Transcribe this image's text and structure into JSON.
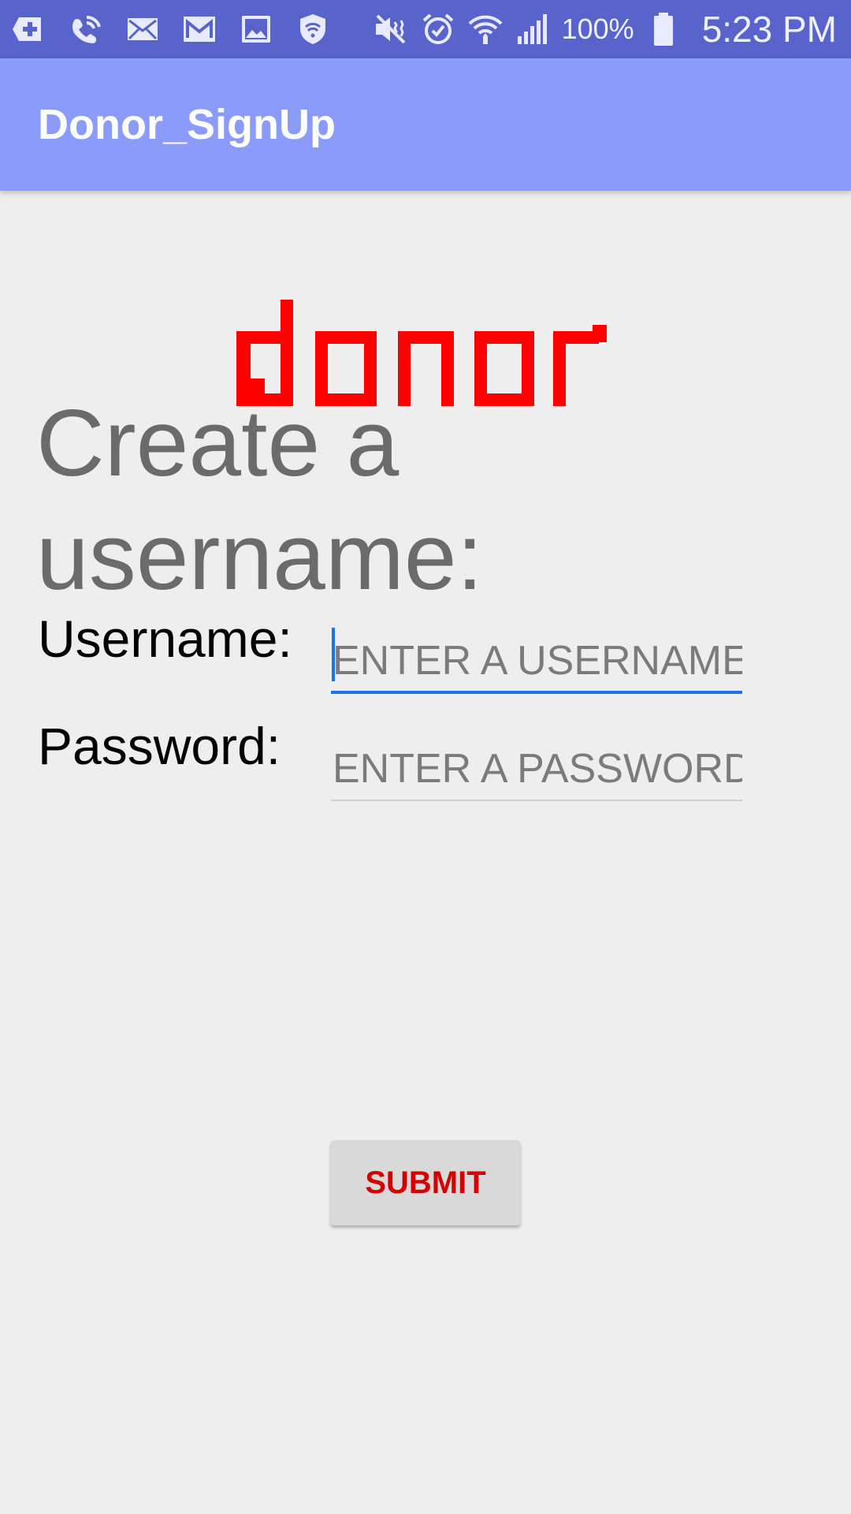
{
  "status_bar": {
    "left_icons": [
      "add-box-icon",
      "wifi-calling-icon",
      "email-icon",
      "gmail-icon",
      "gallery-icon",
      "shield-wifi-icon"
    ],
    "right_icons": [
      "mute-icon",
      "alarm-icon",
      "wifi-icon",
      "signal-icon"
    ],
    "battery_percent": "100%",
    "time": "5:23 PM",
    "bar_color": "#5863cc"
  },
  "app_bar": {
    "title": "Donor_SignUp",
    "color": "#8a9bfa"
  },
  "logo": {
    "text": "donor",
    "color": "#ff0000"
  },
  "form": {
    "heading": "Create a username:",
    "username_label": "Username:",
    "username_placeholder": "ENTER A USERNAME:",
    "username_value": "",
    "password_label": "Password:",
    "password_placeholder": "ENTER A PASSWORD:",
    "password_value": "",
    "focus_color": "#1a73e8"
  },
  "submit": {
    "label": "SUBMIT",
    "text_color": "#d40000"
  }
}
